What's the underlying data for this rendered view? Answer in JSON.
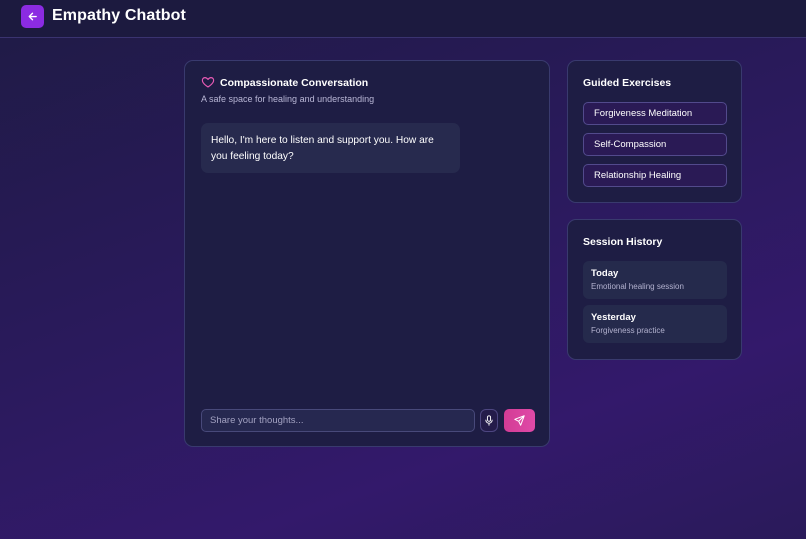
{
  "header": {
    "title": "Empathy Chatbot",
    "back_icon": "arrow-left-icon",
    "accent": "#8b2be2"
  },
  "chat": {
    "title": "Compassionate Conversation",
    "subtitle": "A safe space for healing and understanding",
    "title_icon": "heart-icon",
    "messages": [
      {
        "from": "bot",
        "text": "Hello, I'm here to listen and support you. How are you feeling today?"
      }
    ],
    "input_placeholder": "Share your thoughts...",
    "input_value": "",
    "mic_icon": "microphone-icon",
    "send_icon": "send-icon",
    "send_color": "#d33c95"
  },
  "exercises": {
    "title": "Guided Exercises",
    "items": [
      {
        "label": "Forgiveness Meditation"
      },
      {
        "label": "Self-Compassion"
      },
      {
        "label": "Relationship Healing"
      }
    ]
  },
  "history": {
    "title": "Session History",
    "items": [
      {
        "title": "Today",
        "subtitle": "Emotional healing session"
      },
      {
        "title": "Yesterday",
        "subtitle": "Forgiveness practice"
      }
    ]
  }
}
